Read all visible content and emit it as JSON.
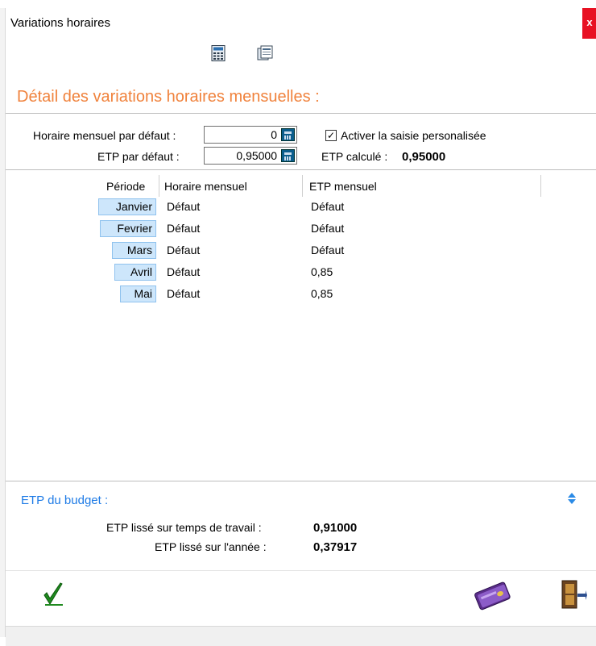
{
  "window": {
    "title": "Variations horaires",
    "close_label": "x"
  },
  "toolbar": {
    "icons": [
      "calculator-icon",
      "document-icon"
    ]
  },
  "heading": "Détail des variations horaires mensuelles :",
  "settings": {
    "horaire_label": "Horaire mensuel par défaut :",
    "horaire_value": "0",
    "etp_label": "ETP par défaut :",
    "etp_value": "0,95000",
    "checkbox_label": "Activer la saisie personalisée",
    "checkbox_checked": true,
    "etp_calc_label": "ETP calculé :",
    "etp_calc_value": "0,95000"
  },
  "table": {
    "headers": {
      "periode": "Période",
      "horaire": "Horaire mensuel",
      "etp": "ETP mensuel"
    },
    "rows": [
      {
        "month": "Janvier",
        "horaire": "Défaut",
        "etp": "Défaut"
      },
      {
        "month": "Fevrier",
        "horaire": "Défaut",
        "etp": "Défaut"
      },
      {
        "month": "Mars",
        "horaire": "Défaut",
        "etp": "Défaut"
      },
      {
        "month": "Avril",
        "horaire": "Défaut",
        "etp": "0,85"
      },
      {
        "month": "Mai",
        "horaire": "Défaut",
        "etp": "0,85"
      }
    ]
  },
  "budget": {
    "title": "ETP du budget :",
    "lisse_travail_label": "ETP lissé sur temps de travail :",
    "lisse_travail_value": "0,91000",
    "lisse_annee_label": "ETP lissé sur l'année :",
    "lisse_annee_value": "0,37917"
  },
  "footer": {
    "icons": [
      "validate-check-icon",
      "payment-card-icon",
      "exit-door-icon"
    ]
  },
  "colors": {
    "heading": "#f0823c",
    "budget_title": "#1e7be6",
    "month_bg": "#cde6fb",
    "close_bg": "#e81123"
  }
}
